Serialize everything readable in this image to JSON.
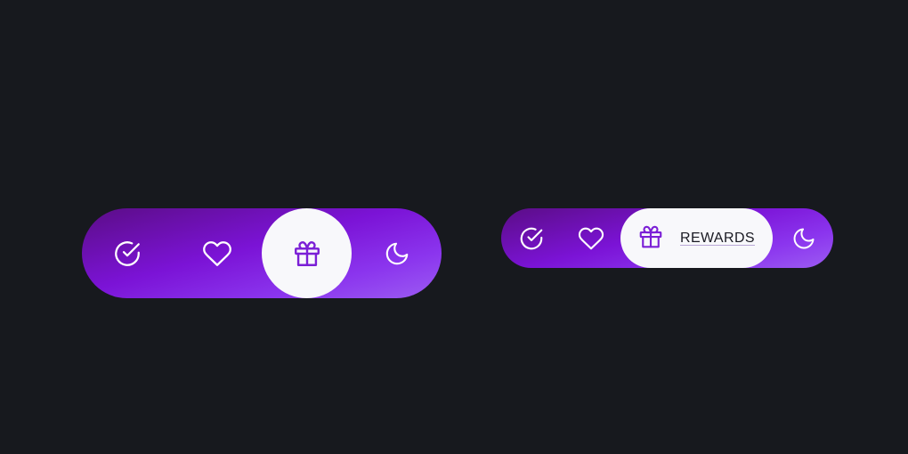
{
  "colors": {
    "background": "#17191e",
    "bar_gradient_start": "#5b0d86",
    "bar_gradient_end": "#9c5cf2",
    "active_pill": "#f8f8fb",
    "active_icon": "#7b1fd6",
    "inactive_icon": "#ffffff"
  },
  "nav_large": {
    "items": [
      {
        "icon": "check-circle-icon",
        "active": false
      },
      {
        "icon": "heart-icon",
        "active": false
      },
      {
        "icon": "gift-icon",
        "active": true
      },
      {
        "icon": "moon-icon",
        "active": false
      }
    ]
  },
  "nav_small": {
    "items": [
      {
        "icon": "check-circle-icon",
        "active": false
      },
      {
        "icon": "heart-icon",
        "active": false
      },
      {
        "icon": "gift-icon",
        "active": true,
        "label": "REWARDS"
      },
      {
        "icon": "moon-icon",
        "active": false
      }
    ]
  }
}
